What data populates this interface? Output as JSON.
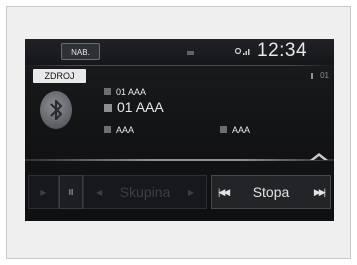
{
  "topbar": {
    "nab_label": "NAB.",
    "clock": "12:34"
  },
  "source": {
    "button_label": "ZDROJ",
    "track_number": "01"
  },
  "track": {
    "folder": "01 AAA",
    "title": "01 AAA",
    "artist": "AAA",
    "album": "AAA"
  },
  "controls": {
    "group_label": "Skupina",
    "track_label": "Stopa",
    "pause_glyph": "II",
    "play_glyph": "▶",
    "prev_glyph": "◀",
    "next_glyph": "▶",
    "skip_back_glyph": "|◀◀",
    "skip_fwd_glyph": "▶▶|"
  }
}
